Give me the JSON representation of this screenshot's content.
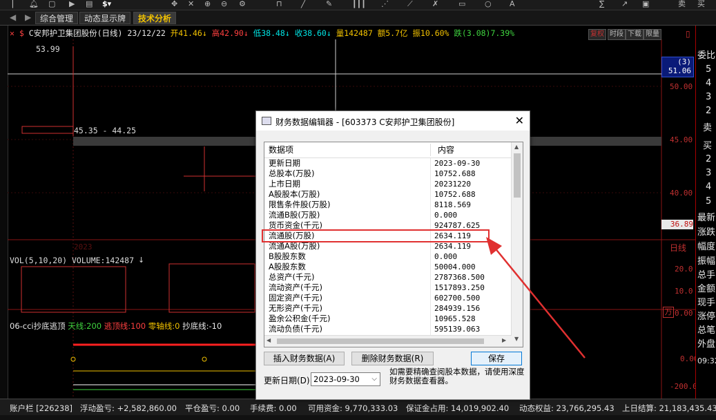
{
  "toolbar": {
    "icons": [
      "bell-icon",
      "window-icon",
      "play-icon",
      "doc-icon",
      "dollar-icon",
      "move-icon",
      "cross-icon",
      "zoom-in-icon",
      "zoom-out-icon",
      "fit-icon",
      "gear-icon",
      "lock-icon",
      "line-icon",
      "pen-icon",
      "bars-icon",
      "brush-icon",
      "tool-icon",
      "shape-icon",
      "circle-icon",
      "text-icon",
      "sigma-icon",
      "trend-icon",
      "window2-icon"
    ],
    "right_labels": [
      "卖",
      "买"
    ]
  },
  "tabs": [
    {
      "label": "综合管理",
      "active": false
    },
    {
      "label": "动态显示牌",
      "active": false
    },
    {
      "label": "技术分析",
      "active": true
    }
  ],
  "chart_header": {
    "title": "C安邦护卫集团股份(日线) 23/12/22",
    "open": "开41.46",
    "high": "高42.90",
    "low": "低38.48",
    "close": "收38.60",
    "volume": "量142487",
    "amount": "额5.7亿",
    "amplitude": "振10.60%",
    "change": "跌(3.08)7.39%",
    "buttons": [
      "复权",
      "时段",
      "下载",
      "限量"
    ]
  },
  "price_chart": {
    "high_label": "53.99",
    "range_label": "45.35 - 44.25",
    "axis_labels": [
      "50.00",
      "45.00",
      "40.00"
    ],
    "current_price": "36.89",
    "badge_top": "(3)",
    "badge_price": "51.06",
    "year_label": "2023",
    "period_label": "日线"
  },
  "volume_panel": {
    "label": "VOL(5,10,20) VOLUME:142487",
    "axis_labels": [
      "20.0",
      "10.0",
      "0.00"
    ],
    "unit": "万"
  },
  "indicator_panel": {
    "name": "06-cci抄底逃顶",
    "items": [
      {
        "text": "天线:200",
        "color": "#3fd43f"
      },
      {
        "text": "逃顶线:100",
        "color": "#ff4040"
      },
      {
        "text": "零轴线:0",
        "color": "#f2c200"
      },
      {
        "text": "抄底线:-10",
        "color": "#e8e8e8"
      }
    ],
    "axis_labels": [
      "0.00",
      "-200.0"
    ]
  },
  "right_panel": {
    "header": "委比",
    "sell_nums": [
      "5",
      "4",
      "3",
      "2"
    ],
    "sell_label": "卖",
    "buy_label": "买",
    "buy_nums": [
      "2",
      "3",
      "4",
      "5"
    ],
    "labels": [
      "最新",
      "涨跌",
      "幅度",
      "振幅",
      "总手",
      "金额",
      "现手",
      "涨停",
      "总笔",
      "外盘"
    ],
    "time": "09:32"
  },
  "status_bar": {
    "account": "账户栏 [226238]",
    "floating_pnl": "浮动盈亏: +2,582,860.00",
    "close_pnl": "平仓盈亏: 0.00",
    "fee": "手续费: 0.00",
    "available": "可用资金: 9,770,333.03",
    "margin": "保证金占用: 14,019,902.40",
    "equity": "动态权益: 23,766,295.43",
    "prev_settle": "上日结算: 21,183,435.43"
  },
  "dialog": {
    "title": "财务数据编辑器 - [603373 C安邦护卫集团股份]",
    "col_item": "数据项",
    "col_content": "内容",
    "rows": [
      {
        "item": "更新日期",
        "value": "2023-09-30"
      },
      {
        "item": "总股本(万股)",
        "value": "10752.688"
      },
      {
        "item": "上市日期",
        "value": "20231220"
      },
      {
        "item": "A股股本(万股)",
        "value": "10752.688"
      },
      {
        "item": "限售条件股(万股)",
        "value": "8118.569"
      },
      {
        "item": "流通B股(万股)",
        "value": "0.000"
      },
      {
        "item": "货币资金(千元)",
        "value": "924787.625"
      },
      {
        "item": "流通股(万股)",
        "value": "2634.119"
      },
      {
        "item": "流通A股(万股)",
        "value": "2634.119"
      },
      {
        "item": "B股股东数",
        "value": "0.000"
      },
      {
        "item": "A股股东数",
        "value": "50004.000"
      },
      {
        "item": "总资产(千元)",
        "value": "2787368.500"
      },
      {
        "item": "流动资产(千元)",
        "value": "1517893.250"
      },
      {
        "item": "固定资产(千元)",
        "value": "602700.500"
      },
      {
        "item": "无形资产(千元)",
        "value": "284939.156"
      },
      {
        "item": "盈余公积金(千元)",
        "value": "10965.528"
      },
      {
        "item": "流动负债(千元)",
        "value": "595139.063"
      }
    ],
    "insert_button": "插入财务数据(A)",
    "delete_button": "删除财务数据(R)",
    "save_button": "保存",
    "date_label": "更新日期(D)",
    "date_value": "2023-09-30",
    "hint": "如需要精确查阅股本数据，请使用深度财务数据查看器。"
  },
  "colors": {
    "highlight": "#e03030",
    "accent": "#f2c200"
  }
}
